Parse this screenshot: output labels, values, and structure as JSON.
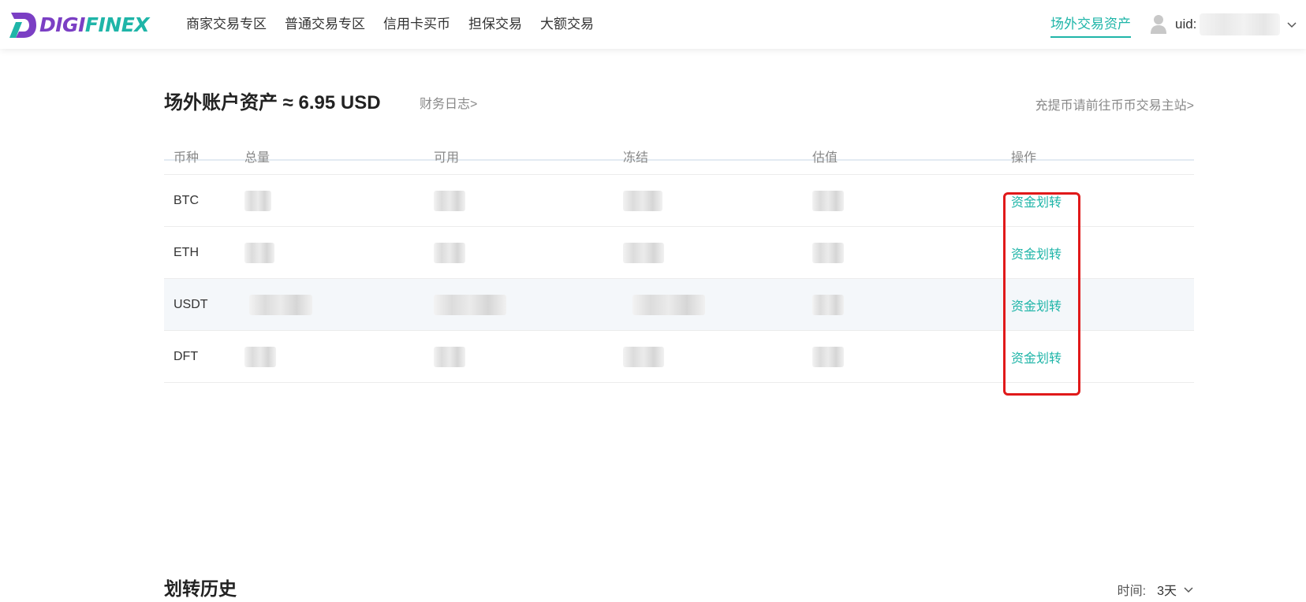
{
  "brand": {
    "logo_text_part1": "DIGI",
    "logo_text_part2": "FINEX",
    "purple": "#7b3fc4",
    "teal": "#1fb5a8"
  },
  "nav": {
    "items": [
      {
        "label": "商家交易专区"
      },
      {
        "label": "普通交易专区"
      },
      {
        "label": "信用卡买币"
      },
      {
        "label": "担保交易"
      },
      {
        "label": "大额交易"
      }
    ],
    "active_right": "场外交易资产",
    "uid_label": "uid:"
  },
  "assets": {
    "title": "场外账户资产 ≈ 6.95 USD",
    "ledger_link": "财务日志>",
    "deposit_link": "充提币请前往币币交易主站>"
  },
  "table": {
    "columns": [
      "币种",
      "总量",
      "可用",
      "冻结",
      "估值",
      "操作"
    ],
    "rows": [
      {
        "coin": "BTC",
        "action": "资金划转"
      },
      {
        "coin": "ETH",
        "action": "资金划转"
      },
      {
        "coin": "USDT",
        "action": "资金划转"
      },
      {
        "coin": "DFT",
        "action": "资金划转"
      }
    ]
  },
  "history": {
    "title": "划转历史",
    "time_label": "时间:",
    "time_value": "3天"
  },
  "colors": {
    "highlight_box": "#e0191a",
    "link": "#1fb5a8"
  }
}
